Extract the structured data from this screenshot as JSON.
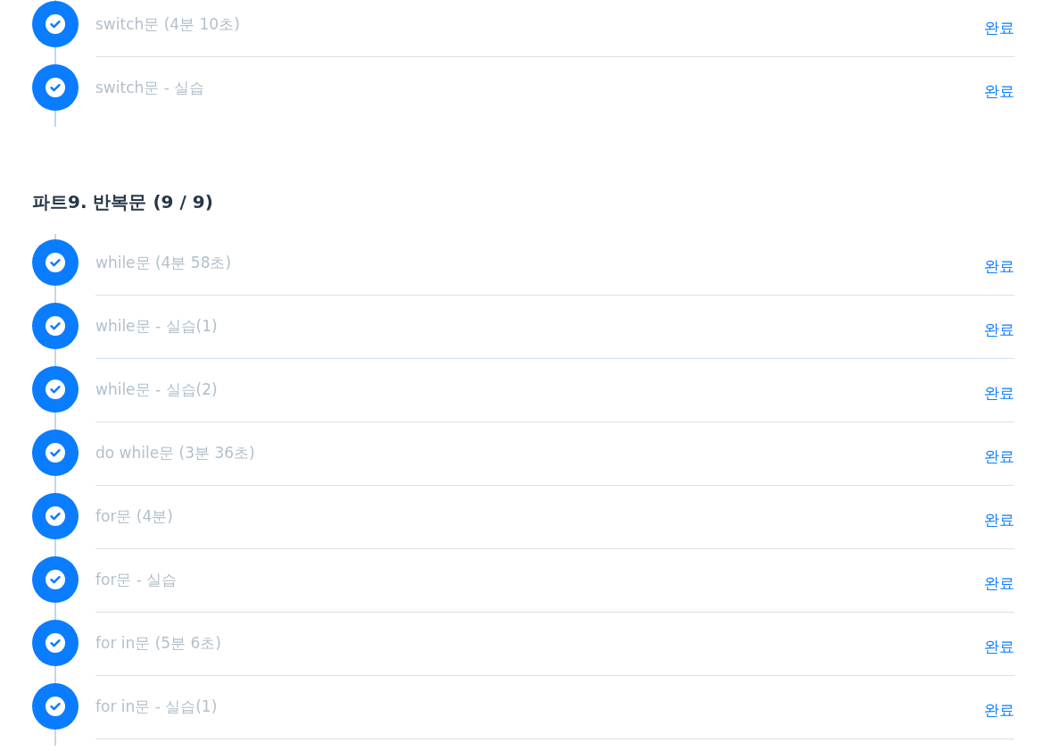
{
  "sections": [
    {
      "lessons": [
        {
          "title": "switch문 (4분 10초)",
          "completed": true,
          "status": "완료"
        },
        {
          "title": "switch문 - 실습",
          "completed": true,
          "status": "완료"
        }
      ]
    },
    {
      "heading": "파트9. 반복문 (9 / 9)",
      "lessons": [
        {
          "title": "while문 (4분 58초)",
          "completed": true,
          "status": "완료"
        },
        {
          "title": "while문 - 실습(1)",
          "completed": true,
          "status": "완료"
        },
        {
          "title": "while문 - 실습(2)",
          "completed": true,
          "status": "완료"
        },
        {
          "title": "do while문 (3분 36초)",
          "completed": true,
          "status": "완료"
        },
        {
          "title": "for문 (4분)",
          "completed": true,
          "status": "완료"
        },
        {
          "title": "for문 - 실습",
          "completed": true,
          "status": "완료"
        },
        {
          "title": "for in문 (5분 6초)",
          "completed": true,
          "status": "완료"
        },
        {
          "title": "for in문 - 실습(1)",
          "completed": true,
          "status": "완료"
        }
      ]
    }
  ]
}
